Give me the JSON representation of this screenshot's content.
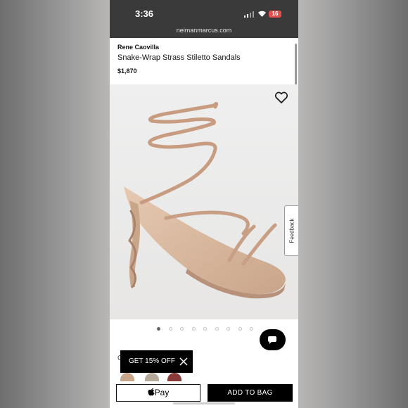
{
  "status_bar": {
    "time": "3:36",
    "battery": "16",
    "url": "neimanmarcus.com"
  },
  "product": {
    "brand": "Rene Caovilla",
    "name": "Snake-Wrap Strass Stiletto Sandals",
    "price": "$1,870"
  },
  "gallery": {
    "image_count": 9,
    "active_index": 0
  },
  "feedback_tab": {
    "label": "Feedback"
  },
  "promo": {
    "label": "GET 15% OFF"
  },
  "section_peek": "C",
  "swatches": [
    "#c9a58a",
    "#b5a99a",
    "#8b3a3a"
  ],
  "actions": {
    "apple_pay_label": "Pay",
    "add_to_bag_label": "ADD TO BAG"
  },
  "colors": {
    "status_bar_bg": "#3a3a3a",
    "battery": "#e34f4f",
    "button_bg": "#000000"
  },
  "icons": [
    "heart-icon",
    "chat-icon",
    "close-icon",
    "apple-icon",
    "wifi-icon",
    "signal-icon"
  ]
}
